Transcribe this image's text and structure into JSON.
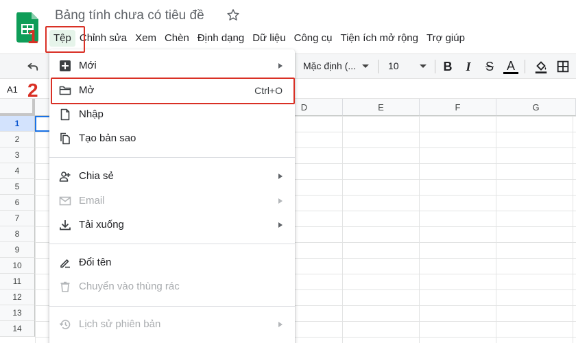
{
  "app": {
    "doc_title": "Bảng tính chưa có tiêu đề"
  },
  "menubar": {
    "items": [
      "Tệp",
      "Chỉnh sửa",
      "Xem",
      "Chèn",
      "Định dạng",
      "Dữ liệu",
      "Công cụ",
      "Tiện ích mở rộng",
      "Trợ giúp"
    ],
    "active": "Tệp"
  },
  "annotations": {
    "step1": "1",
    "step2": "2",
    "highlight_color": "#d93025"
  },
  "toolbar": {
    "font": "Mặc định (...",
    "font_size": "10",
    "bold": "B",
    "italic": "I",
    "strike": "S",
    "text_color": "A"
  },
  "formula_bar": {
    "name_box": "A1"
  },
  "grid": {
    "columns": [
      "D",
      "E",
      "F",
      "G"
    ],
    "rows": [
      "1",
      "2",
      "3",
      "4",
      "5",
      "6",
      "7",
      "8",
      "9",
      "10",
      "11",
      "12",
      "13",
      "14"
    ],
    "selected_row": "1"
  },
  "file_menu": {
    "items": [
      {
        "label": "Mới",
        "icon": "new-icon",
        "submenu": true,
        "disabled": false
      },
      {
        "label": "Mở",
        "icon": "folder-icon",
        "shortcut": "Ctrl+O",
        "disabled": false
      },
      {
        "label": "Nhập",
        "icon": "file-icon",
        "disabled": false
      },
      {
        "label": "Tạo bản sao",
        "icon": "copy-icon",
        "disabled": false
      },
      {
        "label": "Chia sẻ",
        "icon": "share-person-icon",
        "submenu": true,
        "disabled": false
      },
      {
        "label": "Email",
        "icon": "mail-icon",
        "submenu": true,
        "disabled": true
      },
      {
        "label": "Tải xuống",
        "icon": "download-icon",
        "submenu": true,
        "disabled": false
      },
      {
        "label": "Đổi tên",
        "icon": "rename-icon",
        "disabled": false
      },
      {
        "label": "Chuyển vào thùng rác",
        "icon": "trash-icon",
        "disabled": true
      },
      {
        "label": "Lịch sử phiên bản",
        "icon": "history-icon",
        "submenu": true,
        "disabled": true
      }
    ]
  },
  "colors": {
    "brand_green": "#0f9d58",
    "accent_blue": "#1a73e8",
    "menu_active_bg": "#e6f4ea"
  }
}
